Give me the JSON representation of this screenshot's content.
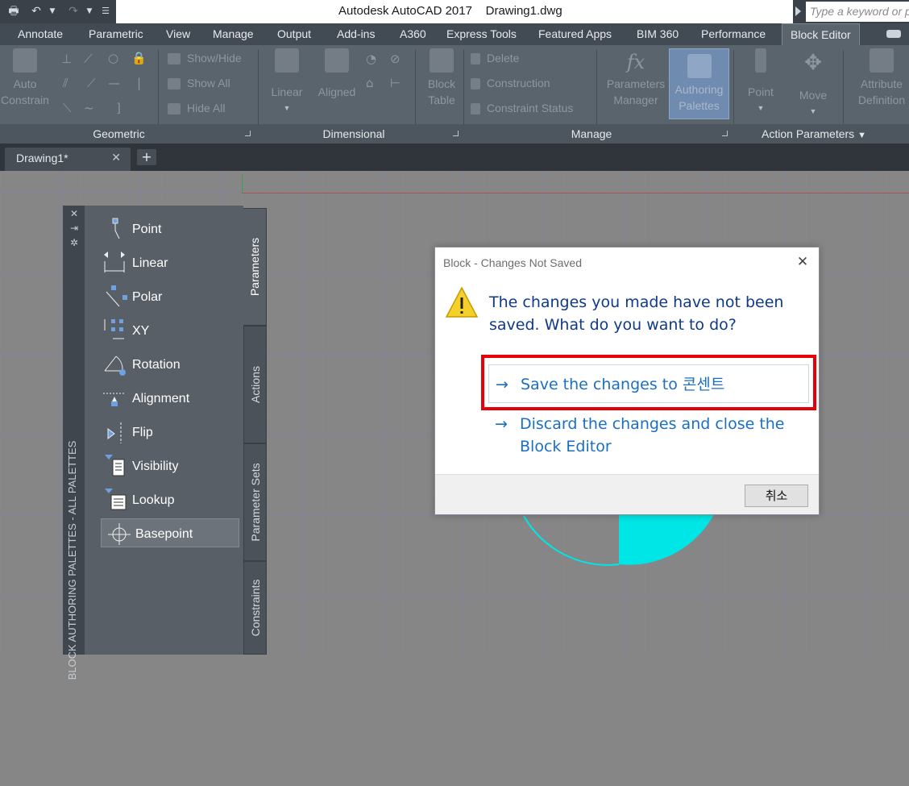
{
  "titlebar": {
    "app_title": "Autodesk AutoCAD 2017",
    "file_name": "Drawing1.dwg",
    "search_placeholder": "Type a keyword or phrase"
  },
  "ribbon": {
    "tabs": [
      "Annotate",
      "Parametric",
      "View",
      "Manage",
      "Output",
      "Add-ins",
      "A360",
      "Express Tools",
      "Featured Apps",
      "BIM 360",
      "Performance",
      "Block Editor"
    ],
    "active_tab": "Block Editor",
    "panels": {
      "geometric": {
        "title": "Geometric",
        "auto_constrain": "Auto Constrain",
        "show_hide": "Show/Hide",
        "show_all": "Show All",
        "hide_all": "Hide All"
      },
      "dimensional": {
        "title": "Dimensional",
        "linear": "Linear",
        "aligned": "Aligned"
      },
      "manage": {
        "title": "Manage",
        "block_table": "Block Table",
        "delete": "Delete",
        "construction": "Construction",
        "constraint_status": "Constraint Status",
        "parameters_manager": "Parameters Manager",
        "authoring_palettes": "Authoring Palettes"
      },
      "action_parameters": {
        "title": "Action Parameters",
        "point": "Point",
        "move": "Move",
        "attribute_definition": "Attribute Definition"
      }
    }
  },
  "document_tab": {
    "name": "Drawing1*"
  },
  "palette": {
    "title": "BLOCK AUTHORING PALETTES - ALL PALETTES",
    "items": [
      "Point",
      "Linear",
      "Polar",
      "XY",
      "Rotation",
      "Alignment",
      "Flip",
      "Visibility",
      "Lookup",
      "Basepoint"
    ],
    "selected": "Basepoint",
    "tabs": [
      "Parameters",
      "Actions",
      "Parameter Sets",
      "Constraints"
    ],
    "active_tab": "Parameters"
  },
  "dialog": {
    "title": "Block - Changes Not Saved",
    "message": "The changes you made have not been saved. What do you want to do?",
    "save_option": "Save the changes to 콘센트",
    "discard_option_line1": "Discard the changes and close the",
    "discard_option_line2": "Block Editor",
    "cancel_label": "취소",
    "arrow": "→"
  },
  "colors": {
    "highlight_box": "#e6000a",
    "dialog_command": "#1b6fc2",
    "dialog_message": "#0f3a8a",
    "cyan_geometry": "#00e5e5"
  }
}
